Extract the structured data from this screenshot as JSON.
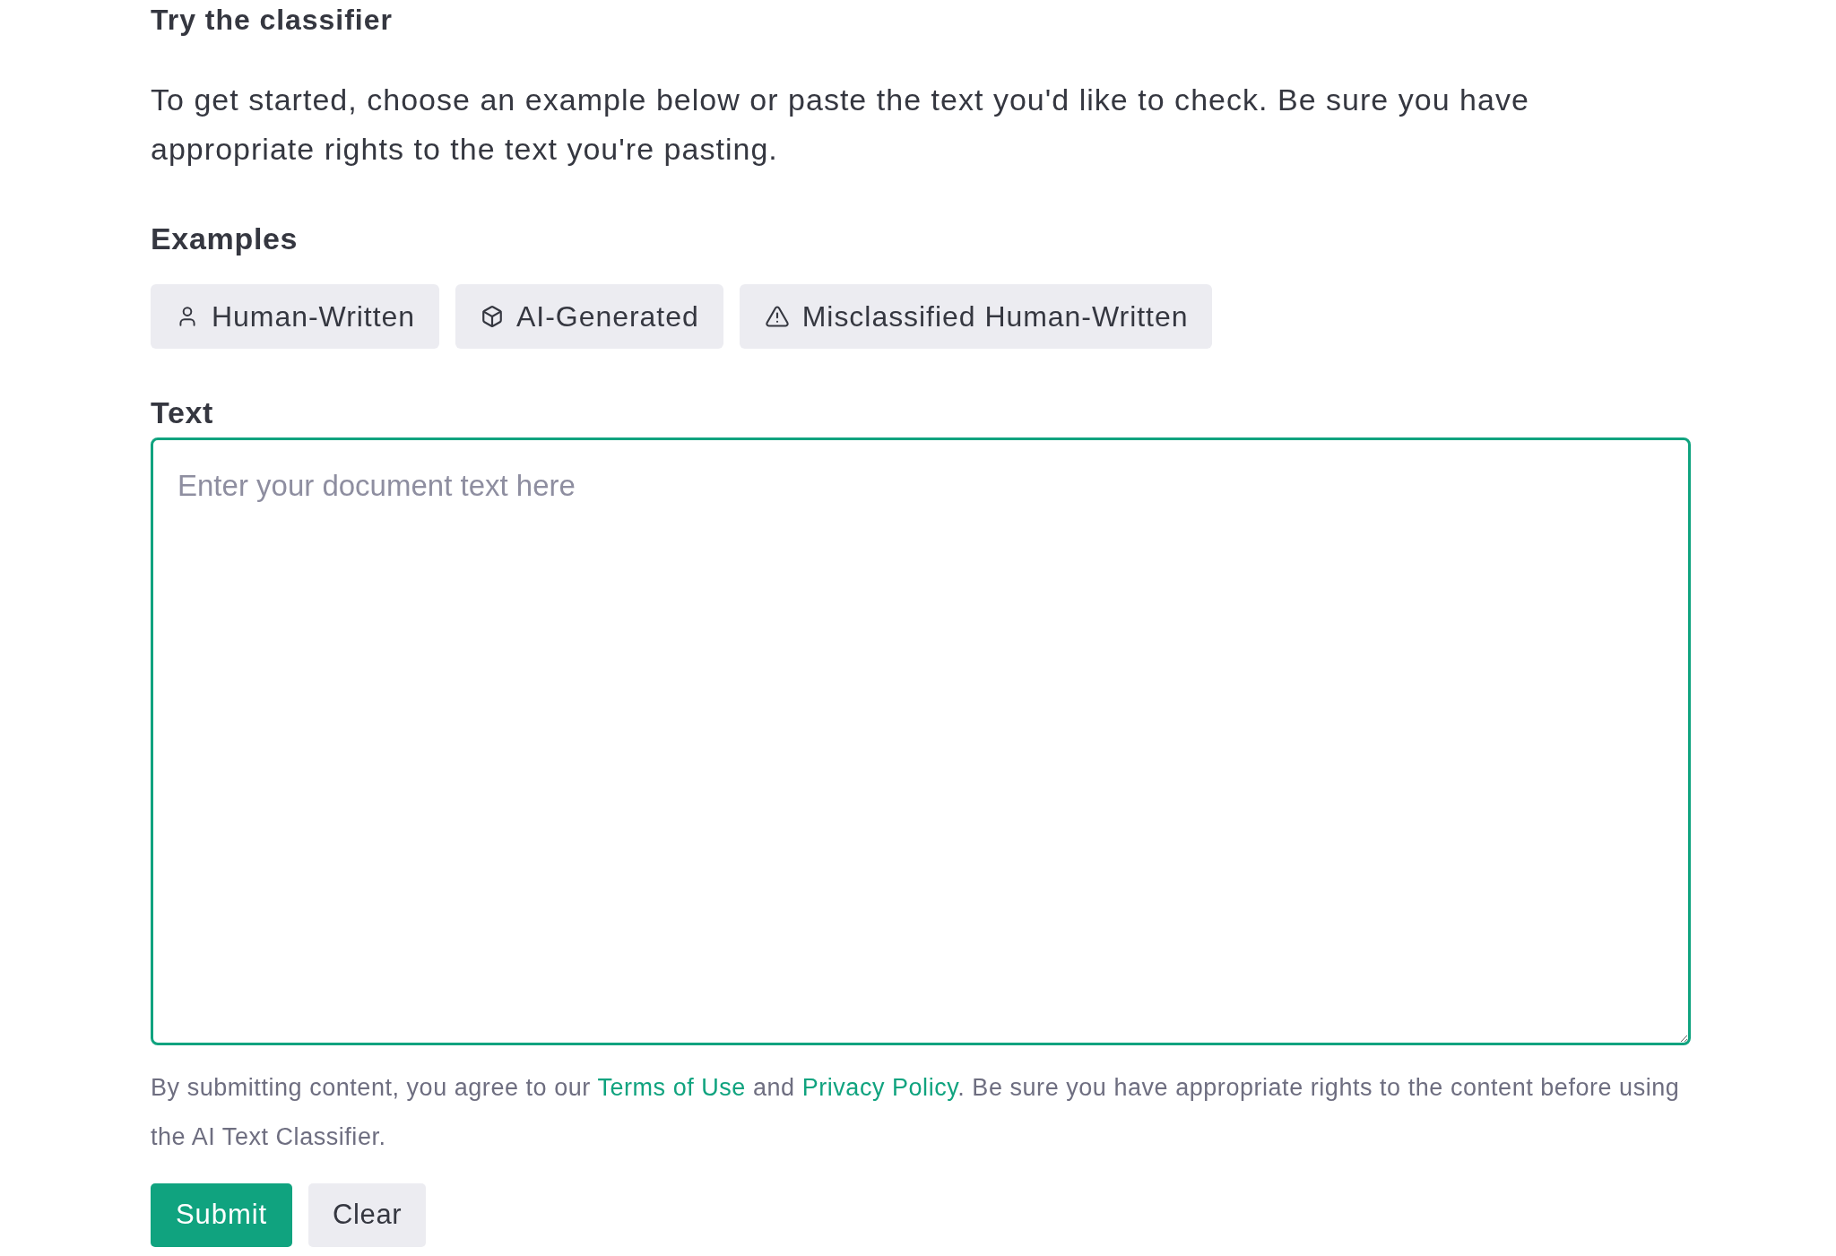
{
  "heading": "Try the classifier",
  "intro": "To get started, choose an example below or paste the text you'd like to check. Be sure you have appropriate rights to the text you're pasting.",
  "examples": {
    "title": "Examples",
    "items": [
      {
        "kind": "human",
        "label": "Human-Written"
      },
      {
        "kind": "ai",
        "label": "AI-Generated"
      },
      {
        "kind": "warning",
        "label": "Misclassified Human-Written"
      }
    ]
  },
  "text_field": {
    "label": "Text",
    "placeholder": "Enter your document text here",
    "focused": true
  },
  "notice": [
    {
      "kind": "text",
      "text": "By submitting content, you agree to our "
    },
    {
      "kind": "link",
      "text": "Terms of Use"
    },
    {
      "kind": "text",
      "text": " and "
    },
    {
      "kind": "link",
      "text": "Privacy Policy"
    },
    {
      "kind": "text",
      "text": ". Be sure you have appropriate rights to the content before using the AI Text Classifier."
    }
  ],
  "actions": [
    {
      "kind": "primary",
      "label": "Submit"
    },
    {
      "kind": "secondary",
      "label": "Clear"
    }
  ]
}
